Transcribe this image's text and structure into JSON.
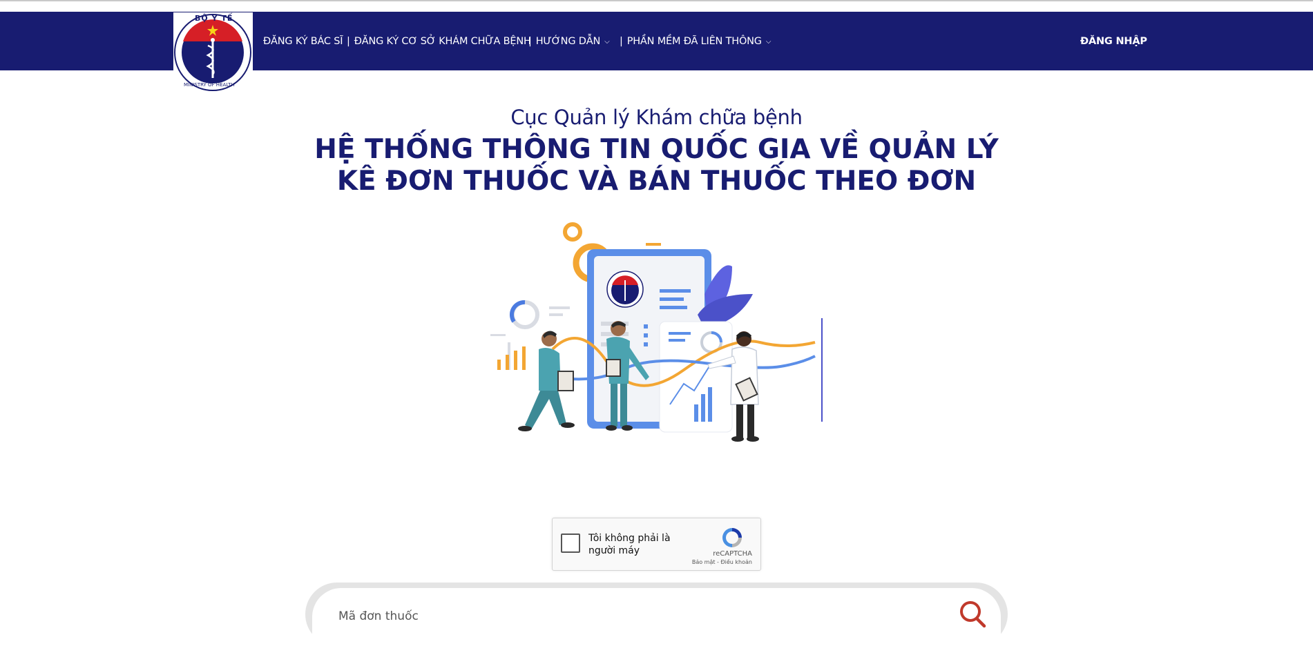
{
  "header": {
    "logo_alt": "Bộ Y Tế - Ministry of Health",
    "logo_top_text": "BỘ Y TẾ",
    "logo_bottom_text": "MINISTRY OF HEALTH",
    "nav": [
      {
        "label": "ĐĂNG KÝ BÁC SĨ",
        "sep": ""
      },
      {
        "label": "ĐĂNG KÝ CƠ SỞ KHÁM CHỮA BỆNH",
        "sep": "|"
      },
      {
        "label": "HƯỚNG DẪN",
        "sep": "|"
      },
      {
        "label": "PHẦN MỀM ĐÃ LIÊN THÔNG",
        "sep": "|"
      }
    ],
    "login_label": "ĐĂNG NHẬP"
  },
  "hero": {
    "subtitle": "Cục Quản lý Khám chữa bệnh",
    "title_line1": "HỆ THỐNG THÔNG TIN QUỐC GIA VỀ QUẢN LÝ",
    "title_line2": "KÊ ĐƠN THUỐC VÀ BÁN THUỐC THEO ĐƠN"
  },
  "captcha": {
    "label": "Tôi không phải là người máy",
    "brand": "reCAPTCHA",
    "links": "Bảo mật - Điều khoản"
  },
  "search": {
    "placeholder": "Mã đơn thuốc"
  },
  "colors": {
    "navy": "#181c71",
    "search_icon": "#c0392b"
  }
}
